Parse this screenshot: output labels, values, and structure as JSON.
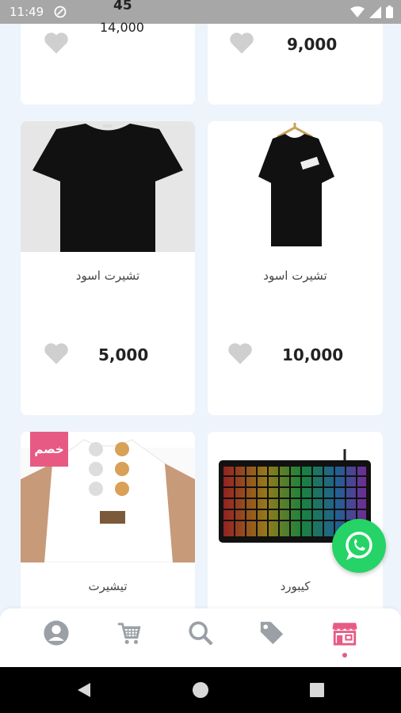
{
  "status_bar": {
    "time": "11:49"
  },
  "top_overlay": {
    "count": "45",
    "price": "14,000"
  },
  "products": [
    {
      "title": "",
      "price": "",
      "liked": false
    },
    {
      "title": "",
      "price": "9,000",
      "liked": false
    },
    {
      "title": "تشيرت اسود",
      "price": "5,000",
      "liked": false
    },
    {
      "title": "تشيرت اسود",
      "price": "10,000",
      "liked": false
    },
    {
      "title": "تيشيرت",
      "price": "",
      "badge": "خصم",
      "liked": false
    },
    {
      "title": "كيبورد",
      "price": "",
      "liked": false
    }
  ],
  "bottom_nav": {
    "items": [
      {
        "icon": "profile-icon"
      },
      {
        "icon": "cart-icon"
      },
      {
        "icon": "search-icon"
      },
      {
        "icon": "tag-icon"
      },
      {
        "icon": "store-icon",
        "active": true
      }
    ],
    "active_color": "#e75a84"
  },
  "whatsapp": {
    "color": "#25d366"
  },
  "colors": {
    "background": "#eef4fb",
    "accent": "#e75a84"
  }
}
